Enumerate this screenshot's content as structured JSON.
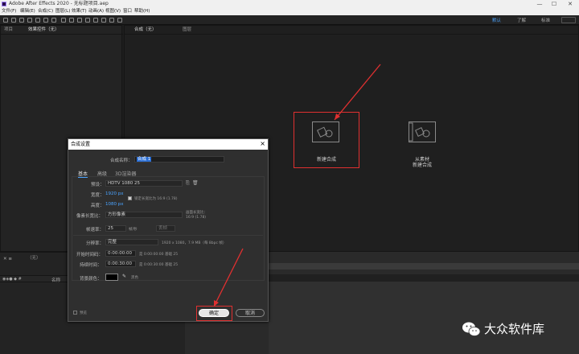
{
  "window": {
    "title": "Adobe After Effects 2020 - 无标题项目.aep",
    "minimize": "—",
    "maximize": "☐",
    "close": "✕"
  },
  "menu": [
    "文件(F)",
    "编辑(E)",
    "合成(C)",
    "图层(L)",
    "效果(T)",
    "动画(A)",
    "视图(V)",
    "窗口",
    "帮助(H)"
  ],
  "workspaces": [
    "默认",
    "了解",
    "标准"
  ],
  "project_panel": {
    "tab": "项目"
  },
  "effects_panel": {
    "tab": "效果控件（无）"
  },
  "comp_panel": {
    "tab": "合成（无）",
    "tab2": "图层"
  },
  "center": {
    "new_comp_label": "新建合成",
    "from_footage_line1": "从素材",
    "from_footage_line2": "新建合成"
  },
  "timeline": {
    "tab": "（无）",
    "col_name": "名称"
  },
  "dialog": {
    "title": "合成设置",
    "close": "×",
    "name_label": "合成名称：",
    "name_value": "合成 1",
    "tabs": [
      "基本",
      "高级",
      "3D渲染器"
    ],
    "preset_label": "预设：",
    "preset_value": "HDTV 1080 25",
    "width_label": "宽度：",
    "width_value": "1920 px",
    "lock_label": "锁定长宽比为 16:9 (1.78)",
    "height_label": "高度：",
    "height_value": "1080 px",
    "pixel_aspect_label": "像素长宽比：",
    "pixel_aspect_value": "方形像素",
    "frame_aspect_label": "画面长宽比：",
    "frame_aspect_value": "16:9 (1.78)",
    "framerate_label": "帧速率：",
    "framerate_value": "25",
    "framerate_unit": "帧/秒",
    "framerate_drop": "丢帧",
    "resolution_label": "分辨率：",
    "resolution_value": "完整",
    "resolution_info": "1920 x 1080，7.9 MB（每 8bpc 帧）",
    "start_label": "开始时间码：",
    "start_value": "0:00:00:00",
    "start_info": "是 0:00:00:00  基础 25",
    "duration_label": "持续时间：",
    "duration_value": "0:00:30:00",
    "duration_info": "是 0:00:30:00  基础 25",
    "bg_label": "背景颜色：",
    "bg_name": "黑色",
    "preview_label": "预览",
    "ok": "确定",
    "cancel": "取消"
  },
  "watermark": {
    "text": "大众软件库"
  },
  "colors": {
    "accent": "#4aa3ff",
    "highlight": "#e03030"
  }
}
